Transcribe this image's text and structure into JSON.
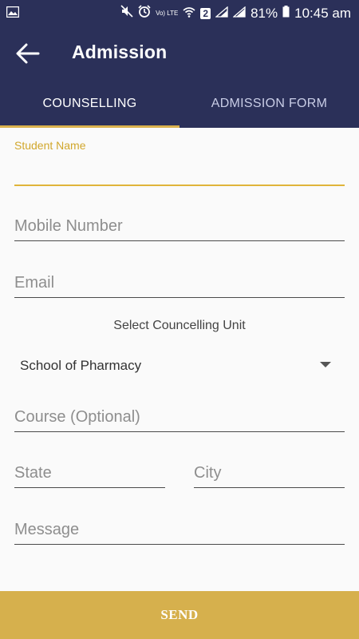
{
  "status_bar": {
    "battery": "81%",
    "time": "10:45 am",
    "sim_badge": "2",
    "volte": "Vo) LTE"
  },
  "app_bar": {
    "title": "Admission",
    "back_icon": "arrow-back-icon"
  },
  "tabs": [
    {
      "label": "COUNSELLING",
      "active": true
    },
    {
      "label": "ADMISSION FORM",
      "active": false
    }
  ],
  "form": {
    "student_name": {
      "label": "Student Name",
      "value": ""
    },
    "mobile_number": {
      "placeholder": "Mobile Number",
      "value": ""
    },
    "email": {
      "placeholder": "Email",
      "value": ""
    },
    "counselling_unit": {
      "label": "Select Councelling Unit",
      "selected": "School of Pharmacy"
    },
    "course": {
      "placeholder": "Course (Optional)",
      "value": ""
    },
    "state": {
      "placeholder": "State",
      "value": ""
    },
    "city": {
      "placeholder": "City",
      "value": ""
    },
    "message": {
      "placeholder": "Message",
      "value": ""
    }
  },
  "send_button": {
    "label": "SEND"
  },
  "colors": {
    "primary": "#2b3059",
    "accent": "#d6b04d",
    "focus_label": "#d1a72c",
    "background": "#fafafa"
  }
}
